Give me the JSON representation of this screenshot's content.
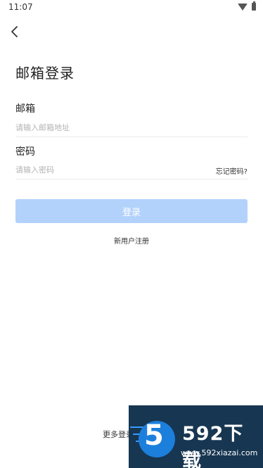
{
  "status_bar": {
    "time": "11:07"
  },
  "page": {
    "title": "邮箱登录"
  },
  "email": {
    "label": "邮箱",
    "placeholder": "请输入邮箱地址",
    "value": ""
  },
  "password": {
    "label": "密码",
    "placeholder": "请输入密码",
    "value": "",
    "forgot_label": "忘记密码?"
  },
  "login_button": {
    "label": "登录",
    "color": "#b3d2fb"
  },
  "register_link": "新用户注册",
  "more_login": "更多登录",
  "watermark": {
    "digit": "5",
    "brand": "592下载",
    "url": "www.592xiazai.com"
  }
}
